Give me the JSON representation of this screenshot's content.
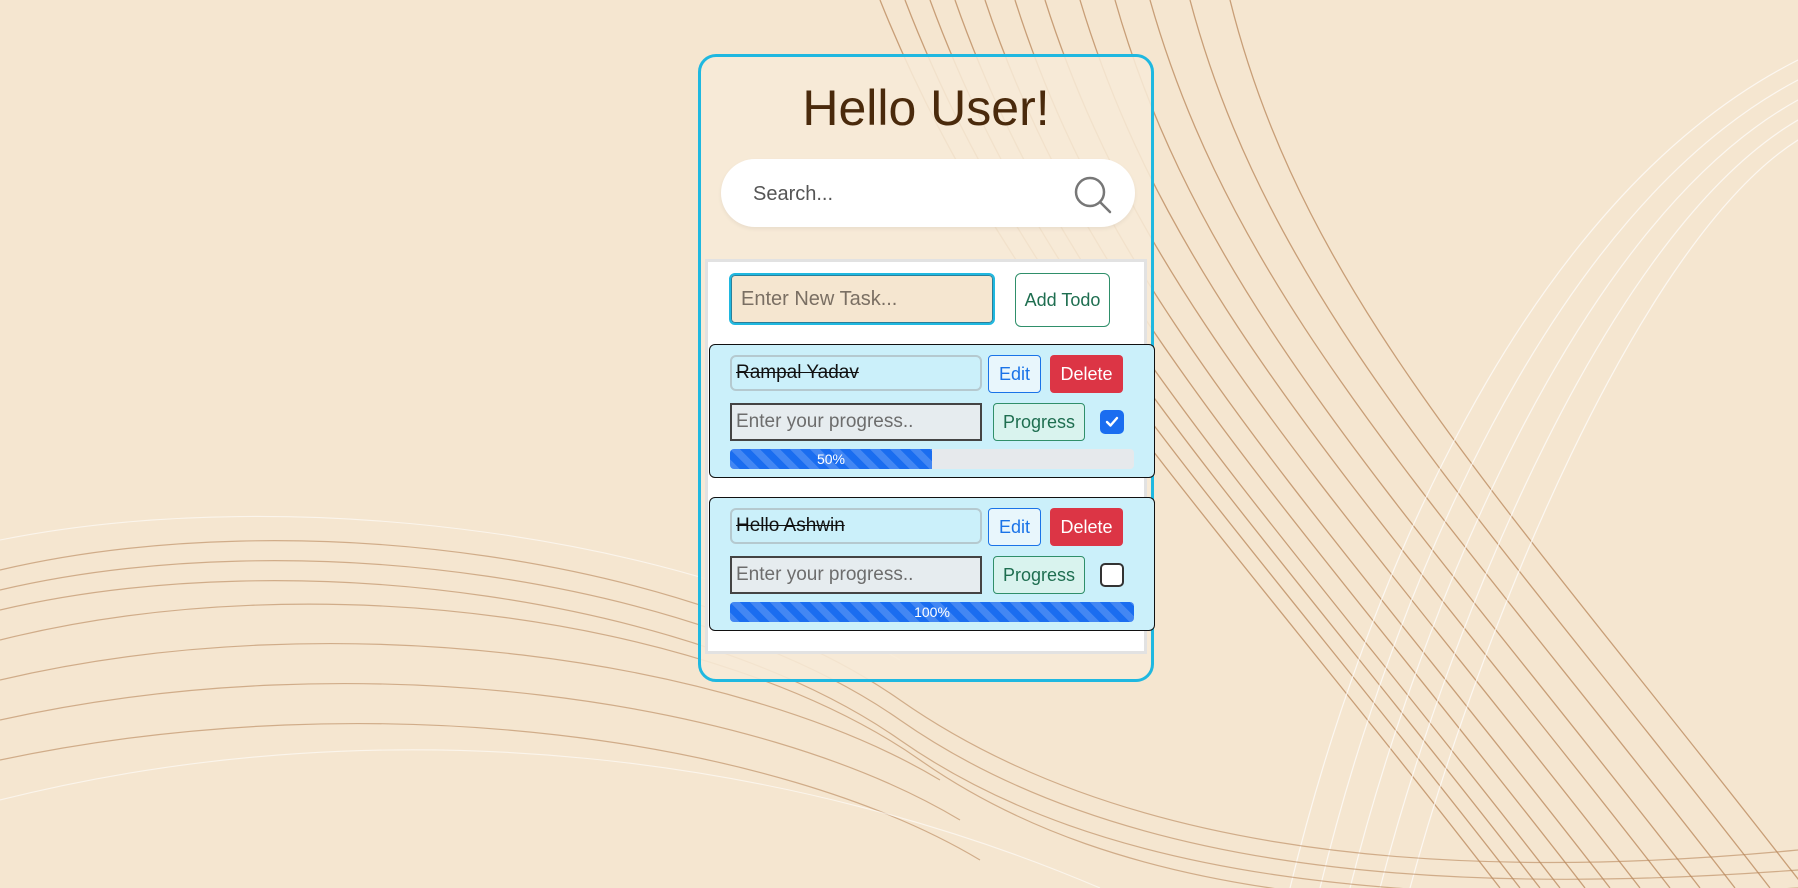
{
  "header": {
    "title": "Hello User!"
  },
  "search": {
    "placeholder": "Search..."
  },
  "new_task": {
    "placeholder": "Enter New Task...",
    "add_label": "Add Todo"
  },
  "todos": [
    {
      "title": "Rampal Yadav",
      "edit_label": "Edit",
      "delete_label": "Delete",
      "progress_placeholder": "Enter your progress..",
      "progress_label": "Progress",
      "completed": true,
      "progress": 50,
      "progress_text": "50%"
    },
    {
      "title": "Hello Ashwin",
      "edit_label": "Edit",
      "delete_label": "Delete",
      "progress_placeholder": "Enter your progress..",
      "progress_label": "Progress",
      "completed": false,
      "progress": 100,
      "progress_text": "100%"
    }
  ],
  "colors": {
    "accent": "#1fb8e0",
    "delete": "#dc3545",
    "progress": "#1a6df0",
    "todo_bg": "#cbf0fa"
  },
  "icons": {
    "search": "search-icon",
    "check": "check-icon"
  }
}
